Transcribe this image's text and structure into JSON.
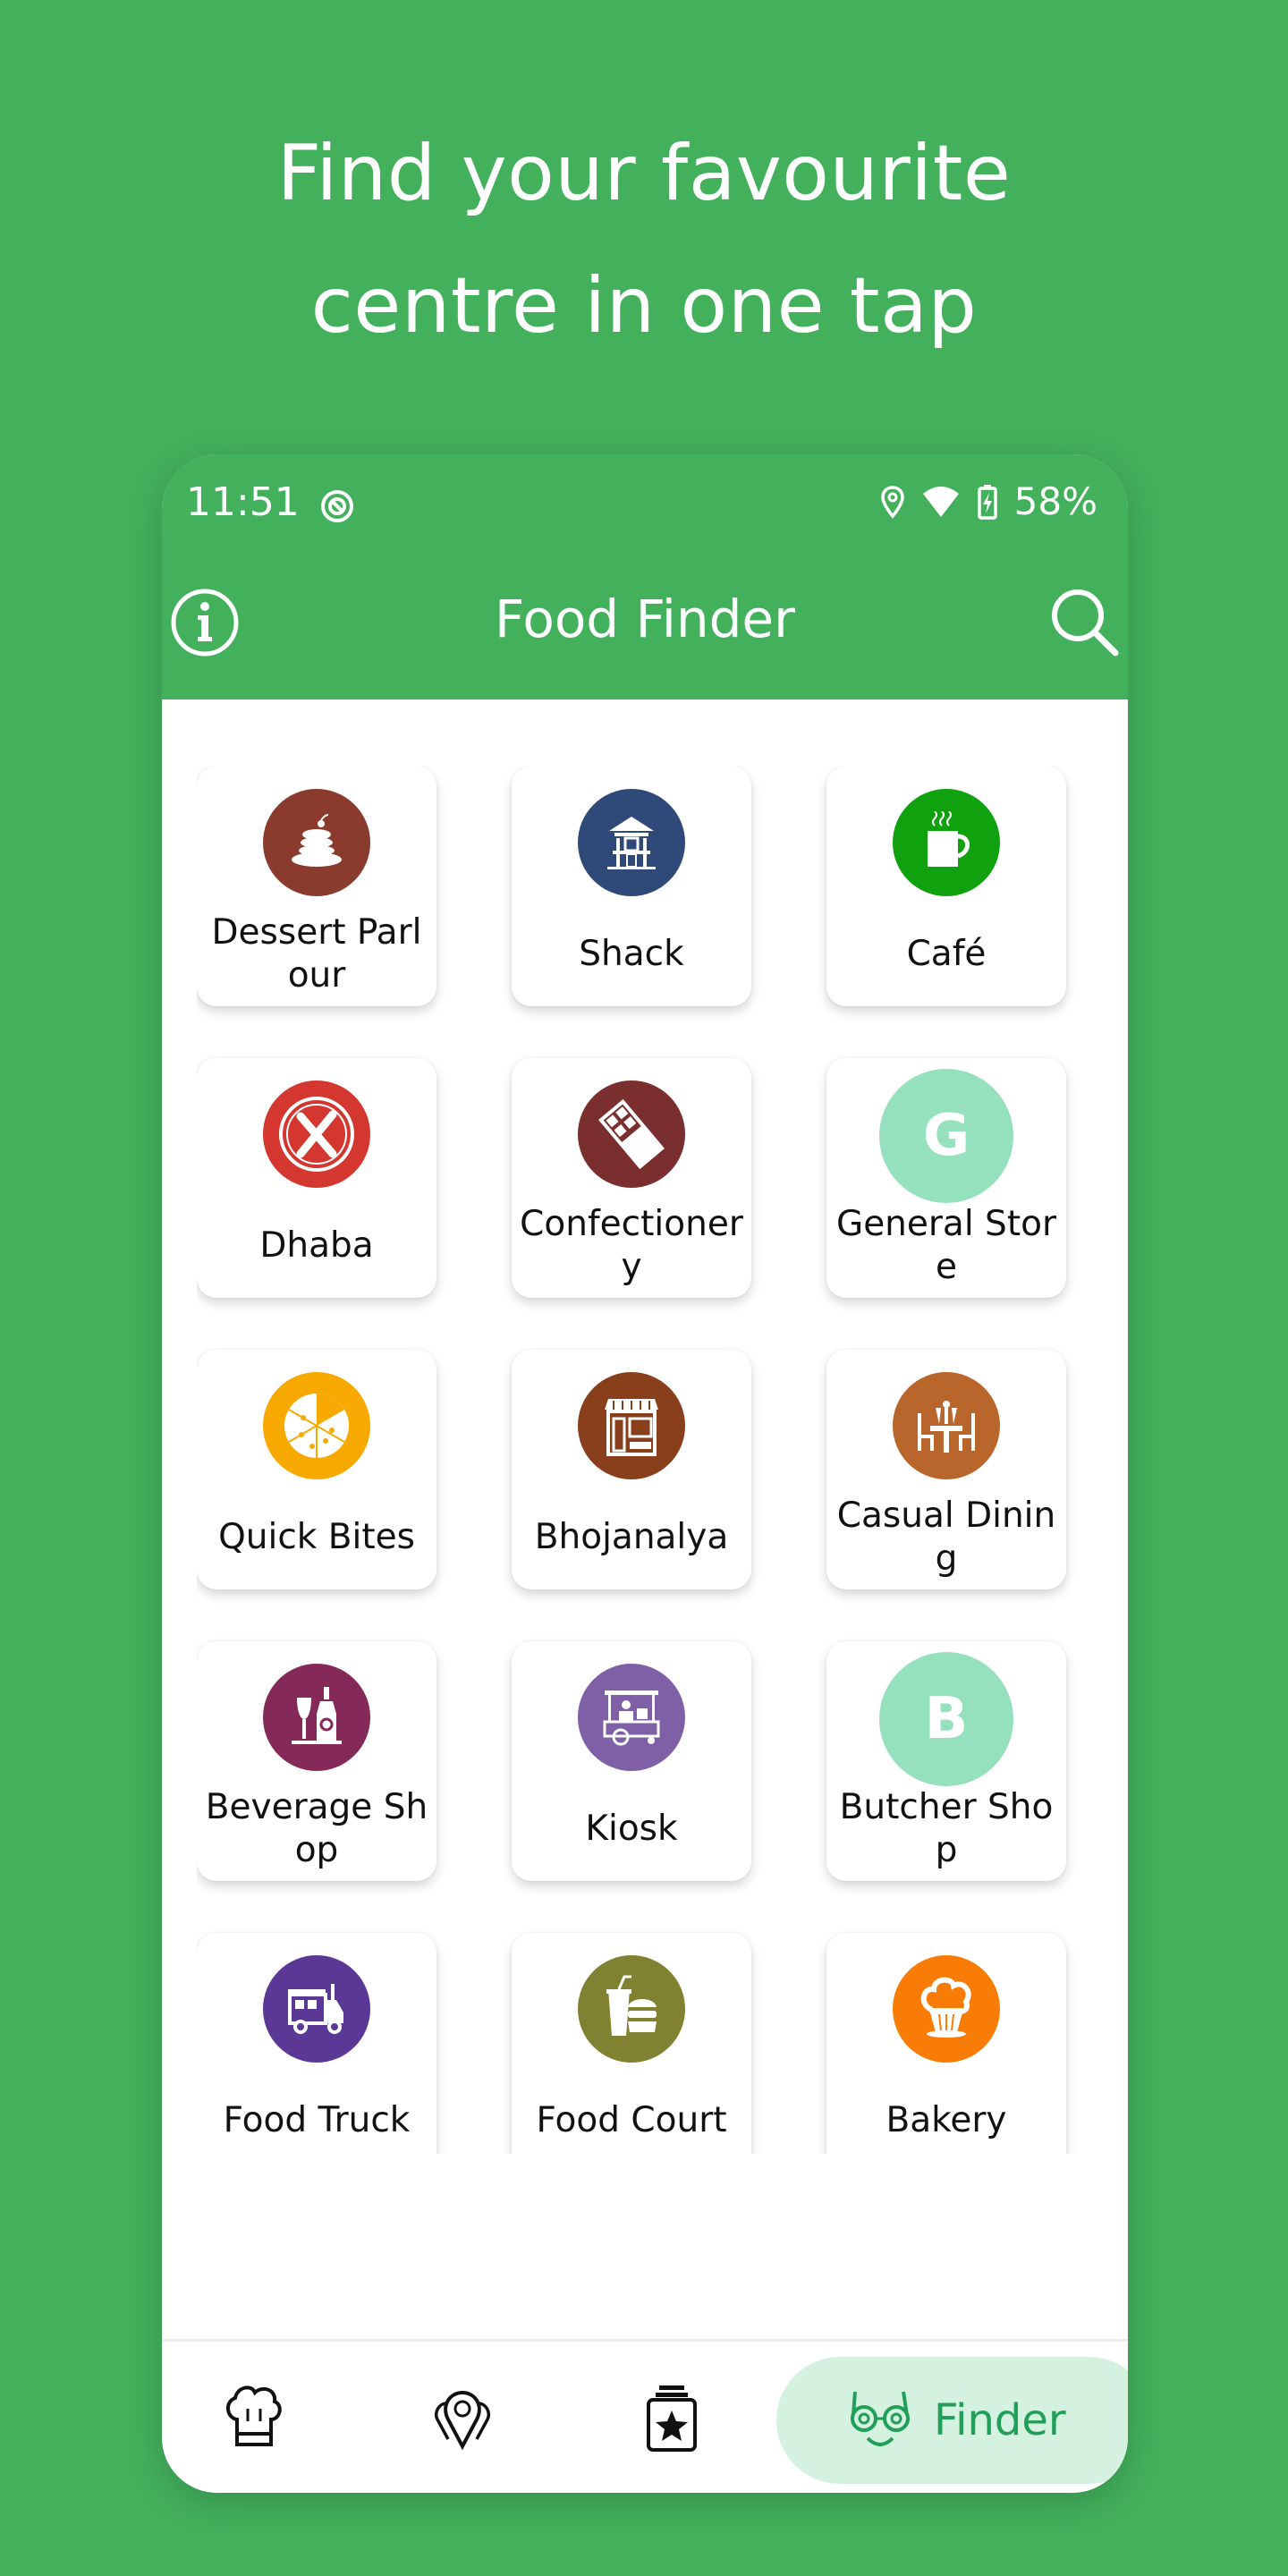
{
  "headline": {
    "line1": "Find your favourite",
    "line2": "centre in one tap"
  },
  "status_bar": {
    "time": "11:51",
    "battery": "58%",
    "icons": [
      "do-not-disturb-icon",
      "location-icon",
      "wifi-icon",
      "battery-charging-icon"
    ]
  },
  "app_bar": {
    "title": "Food Finder",
    "left_icon": "info-icon",
    "right_icon": "search-icon"
  },
  "categories": [
    {
      "label": "Dessert Parlour",
      "icon": "pancake-icon",
      "color": "#8b3a2e"
    },
    {
      "label": "Shack",
      "icon": "shack-icon",
      "color": "#2f4a78"
    },
    {
      "label": "Café",
      "icon": "coffee-mug-icon",
      "color": "#10a10f"
    },
    {
      "label": "Dhaba",
      "icon": "fork-knife-plate-icon",
      "color": "#d3372f"
    },
    {
      "label": "Confectionery",
      "icon": "chocolate-bar-icon",
      "color": "#7a2e2e"
    },
    {
      "label": "General Store",
      "icon": "letter-g-avatar",
      "letter": "G",
      "color": "#95e0bd"
    },
    {
      "label": "Quick Bites",
      "icon": "pizza-icon",
      "color": "#f8a900"
    },
    {
      "label": "Bhojanalya",
      "icon": "storefront-icon",
      "color": "#8a3f1c"
    },
    {
      "label": "Casual Dining",
      "icon": "dining-table-icon",
      "color": "#b9662d"
    },
    {
      "label": "Beverage Shop",
      "icon": "wine-bottle-icon",
      "color": "#842958"
    },
    {
      "label": "Kiosk",
      "icon": "kiosk-cart-icon",
      "color": "#7f5fa6"
    },
    {
      "label": "Butcher Shop",
      "icon": "letter-b-avatar",
      "letter": "B",
      "color": "#95e0bd"
    },
    {
      "label": "Food Truck",
      "icon": "food-truck-icon",
      "color": "#5b3796"
    },
    {
      "label": "Food Court",
      "icon": "burger-drink-icon",
      "color": "#818231"
    },
    {
      "label": "Bakery",
      "icon": "cupcake-icon",
      "color": "#f97c06"
    }
  ],
  "bottom_nav": {
    "items": [
      {
        "icon": "chef-hat-icon"
      },
      {
        "icon": "map-pins-icon"
      },
      {
        "icon": "star-jar-icon"
      },
      {
        "icon": "glasses-face-icon",
        "label": "Finder",
        "active": true
      }
    ]
  },
  "colors": {
    "brand_green": "#43b05c",
    "active_nav_bg": "#d5f1e0",
    "active_nav_fg": "#1f9f57"
  }
}
